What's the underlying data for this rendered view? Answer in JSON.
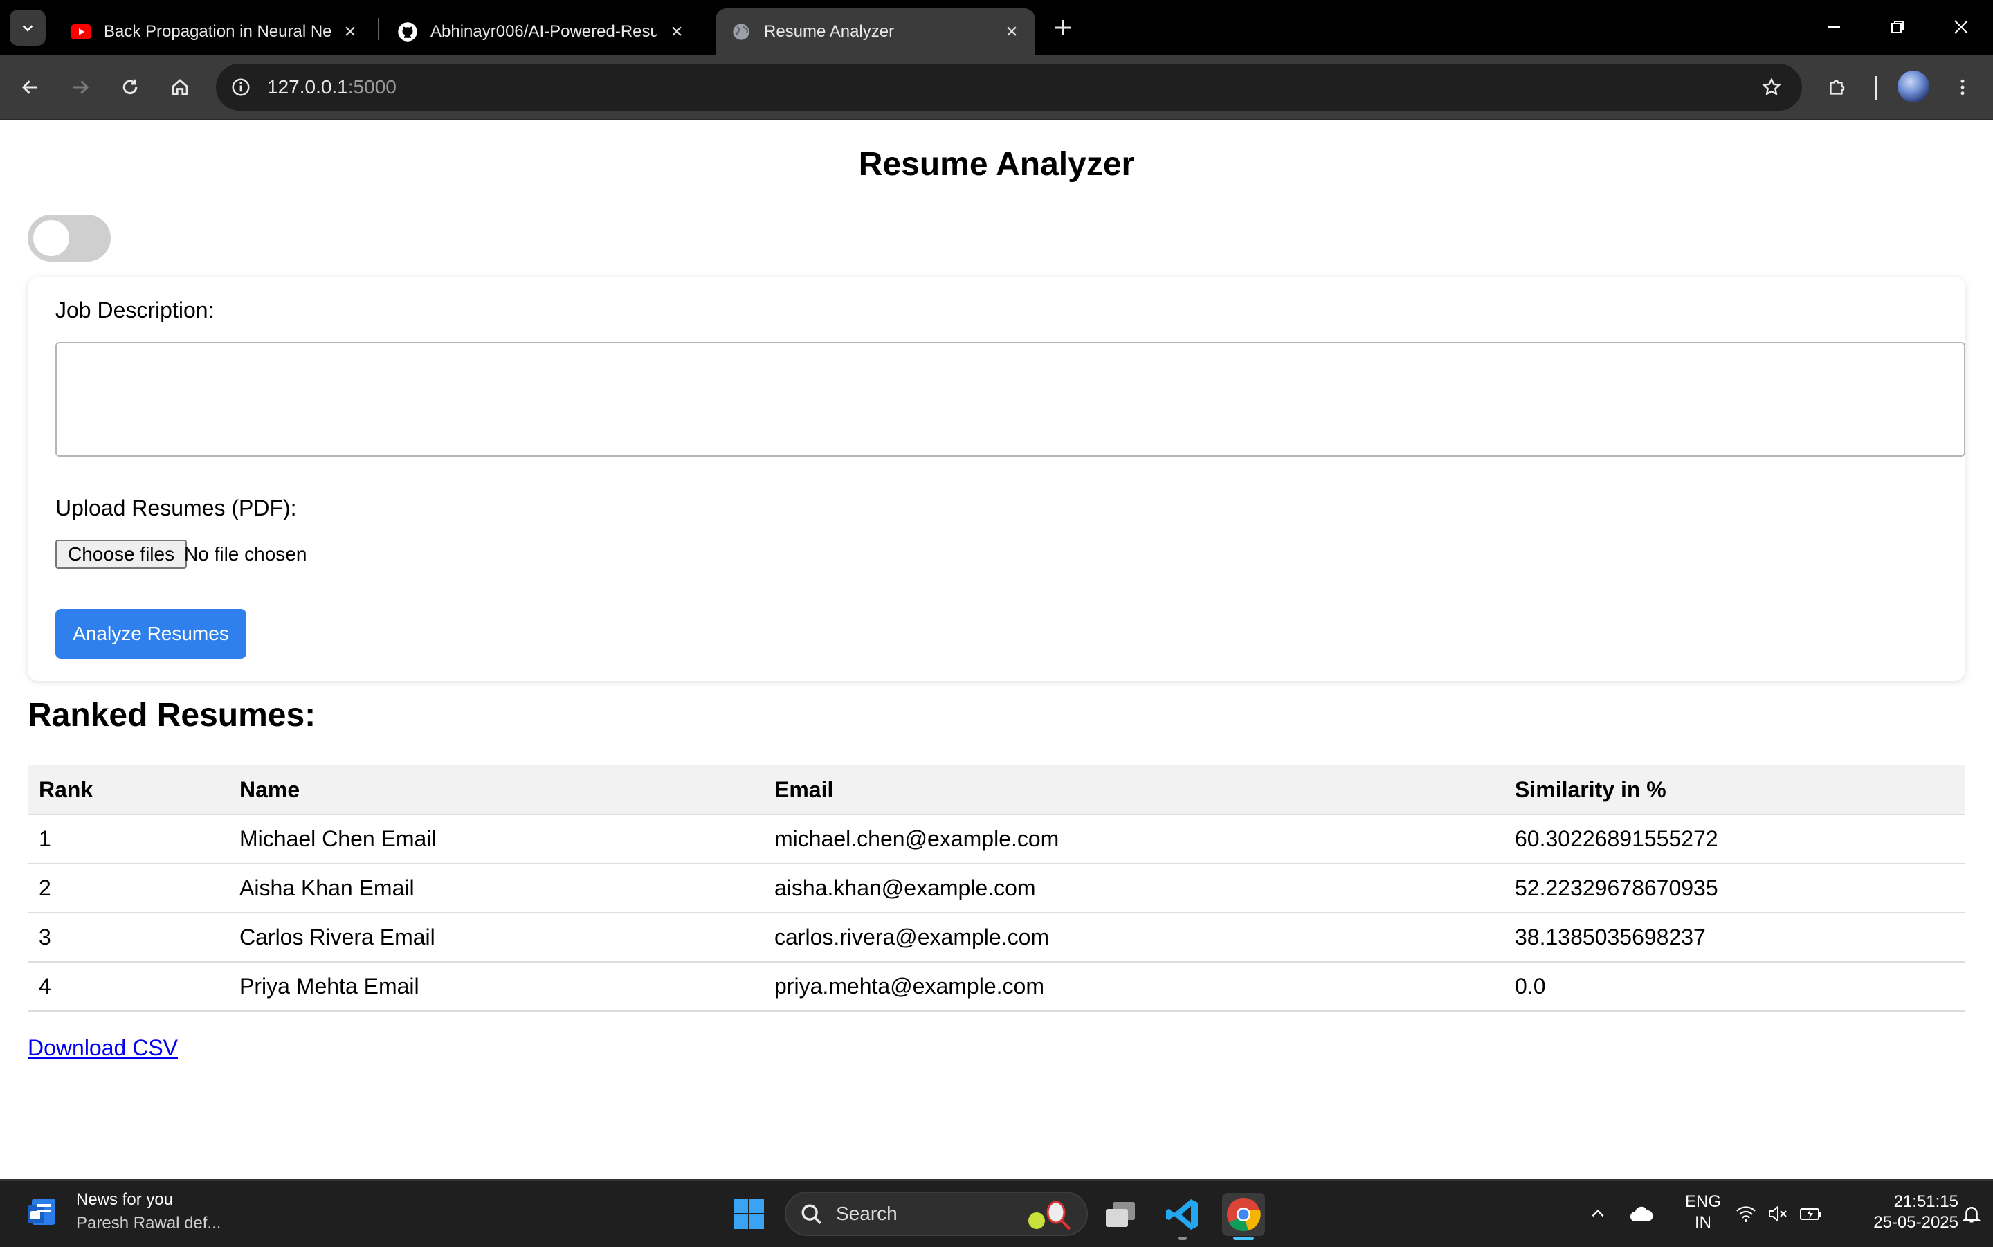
{
  "browser": {
    "tabs": [
      {
        "title": "Back Propagation in Neural Net",
        "favicon": "youtube-icon",
        "active": false
      },
      {
        "title": "Abhinayr006/AI-Powered-Resu",
        "favicon": "github-icon",
        "active": false
      },
      {
        "title": "Resume Analyzer",
        "favicon": "globe-icon",
        "active": true
      }
    ],
    "url_host": "127.0.0.1",
    "url_port": ":5000"
  },
  "page": {
    "title": "Resume Analyzer",
    "dark_mode_on": false,
    "form": {
      "job_description_label": "Job Description:",
      "job_description_value": "",
      "upload_label": "Upload Resumes (PDF):",
      "choose_files_label": "Choose files",
      "file_status": "No file chosen",
      "analyze_button": "Analyze Resumes"
    },
    "results": {
      "heading": "Ranked Resumes:",
      "columns": [
        "Rank",
        "Name",
        "Email",
        "Similarity in %"
      ],
      "rows": [
        {
          "rank": "1",
          "name": "Michael Chen Email",
          "email": "michael.chen@example.com",
          "similarity": "60.30226891555272"
        },
        {
          "rank": "2",
          "name": "Aisha Khan Email",
          "email": "aisha.khan@example.com",
          "similarity": "52.22329678670935"
        },
        {
          "rank": "3",
          "name": "Carlos Rivera Email",
          "email": "carlos.rivera@example.com",
          "similarity": "38.1385035698237"
        },
        {
          "rank": "4",
          "name": "Priya Mehta Email",
          "email": "priya.mehta@example.com",
          "similarity": "0.0"
        }
      ]
    },
    "download_link": "Download CSV"
  },
  "taskbar": {
    "news_title": "News for you",
    "news_subtitle": "Paresh Rawal def...",
    "search_placeholder": "Search",
    "lang_line1": "ENG",
    "lang_line2": "IN",
    "time": "21:51:15",
    "date": "25-05-2025"
  },
  "colors": {
    "accent_button": "#2f80ed",
    "link": "#0000ee",
    "table_header_bg": "#f2f2f2",
    "toggle_off": "#cfcfcf"
  }
}
